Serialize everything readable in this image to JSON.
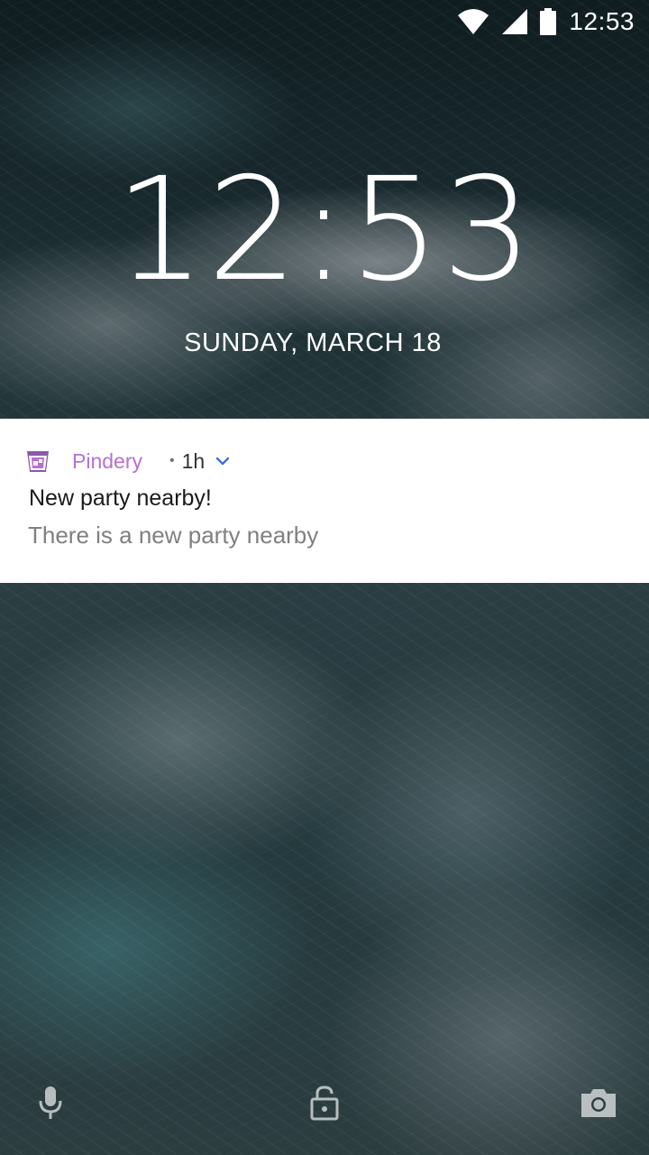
{
  "status_bar": {
    "time": "12:53",
    "icons": [
      "wifi-icon",
      "signal-icon",
      "battery-icon"
    ]
  },
  "lockscreen": {
    "clock": "12:53",
    "date": "SUNDAY, MARCH 18"
  },
  "notification": {
    "app_name": "Pindery",
    "separator": "•",
    "time_ago": "1h",
    "title": "New party nearby!",
    "text": "There is a new party nearby",
    "app_color": "#b86fd0",
    "expand_icon": "chevron-down-icon"
  },
  "bottom_actions": {
    "left": "microphone-icon",
    "center": "unlock-icon",
    "right": "camera-icon"
  }
}
